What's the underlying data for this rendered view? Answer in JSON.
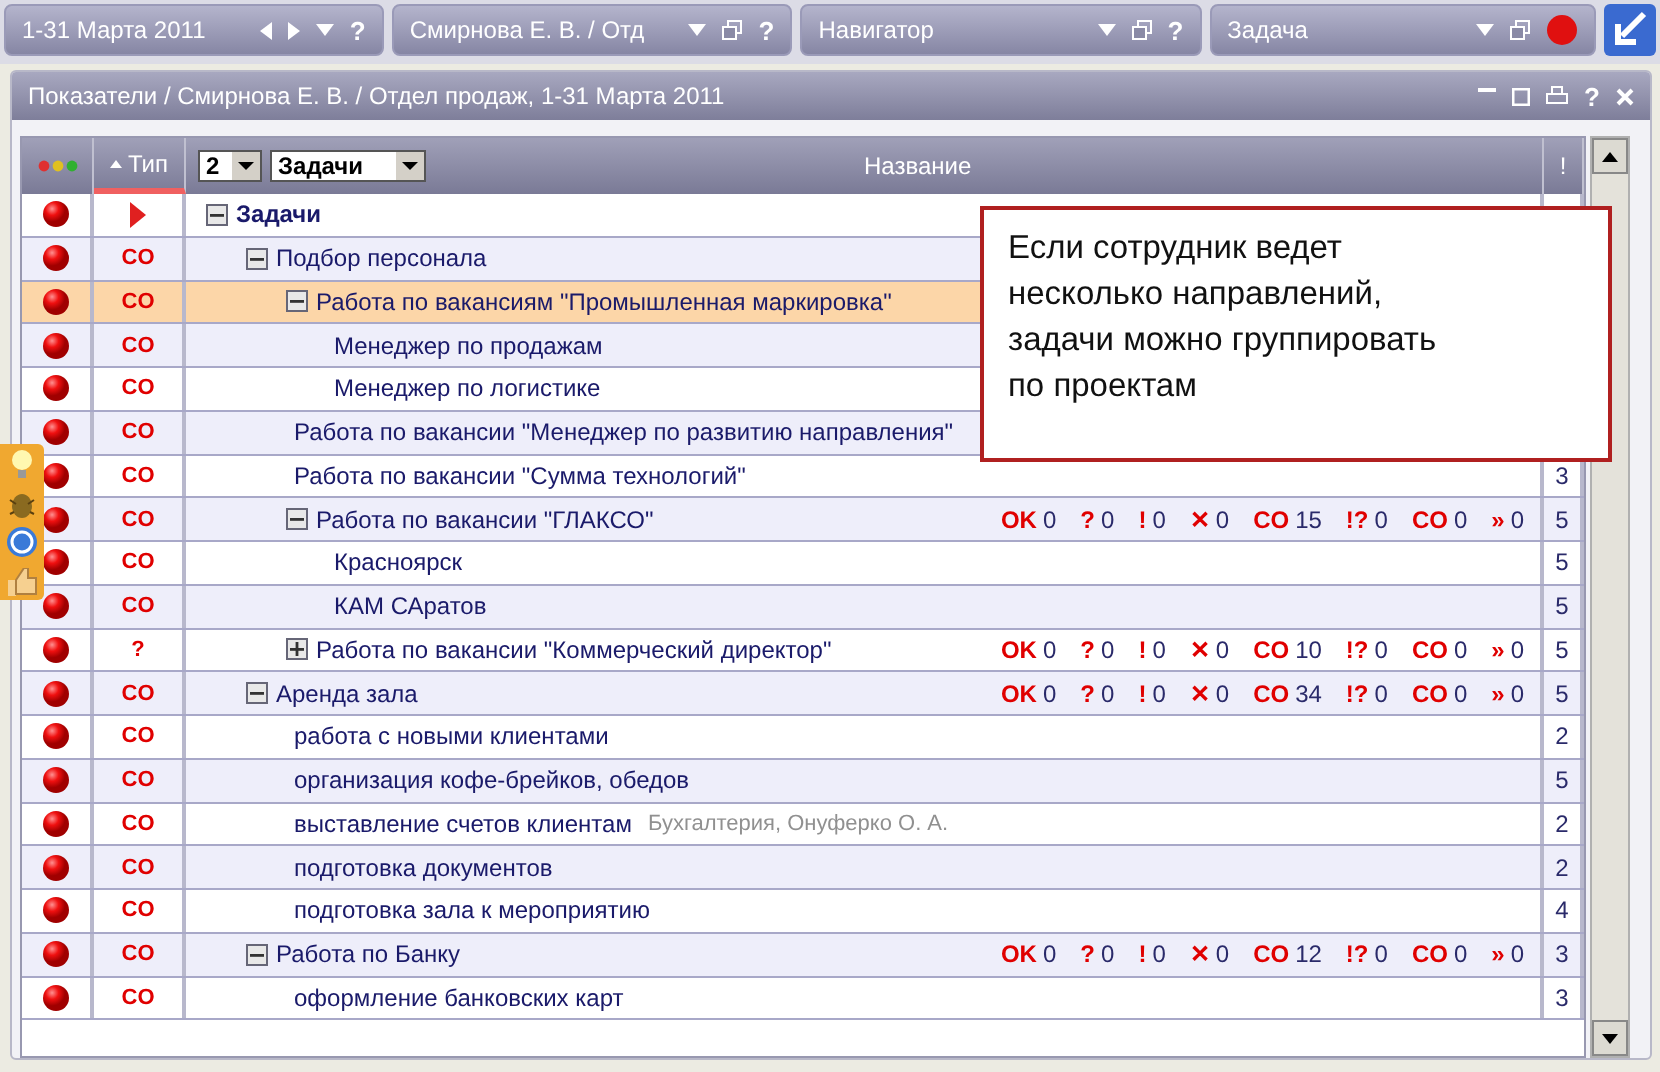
{
  "top_bar": [
    {
      "label": "1-31 Марта 2011",
      "nav_arrows": true,
      "restore": false,
      "help": "?"
    },
    {
      "label": "Смирнова Е. В. / Отд",
      "nav_arrows": false,
      "restore": true,
      "help": "?"
    },
    {
      "label": "Навигатор",
      "nav_arrows": false,
      "restore": true,
      "help": "?"
    },
    {
      "label": "Задача",
      "nav_arrows": false,
      "restore": true,
      "notification": true
    }
  ],
  "window": {
    "title": "Показатели / Смирнова Е. В. / Отдел продаж, 1-31 Марта 2011",
    "help": "?"
  },
  "table": {
    "columns": {
      "type": "Тип",
      "level_select": "2",
      "group_select": "Задачи",
      "name": "Название",
      "count": "!"
    },
    "rows": [
      {
        "name": "Задачи",
        "type": {
          "kind": "arrow"
        },
        "expanded": true,
        "selected": false,
        "children": [
          {
            "name": "Подбор персонала",
            "type": {
              "kind": "text",
              "label": "CO"
            },
            "expanded": true,
            "selected": false,
            "children": [
              {
                "name": "Работа по вакансиям \"Промышленная маркировка\"",
                "type": {
                  "kind": "text",
                  "label": "CO"
                },
                "expanded": true,
                "selected": true,
                "children": [
                  {
                    "name": "Менеджер по продажам",
                    "type": {
                      "kind": "text",
                      "label": "CO"
                    },
                    "selected": false
                  },
                  {
                    "name": "Менеджер по логистике",
                    "type": {
                      "kind": "text",
                      "label": "CO"
                    },
                    "selected": false
                  }
                ]
              },
              {
                "name": "Работа по вакансии \"Менеджер по развитию направления\"",
                "type": {
                  "kind": "text",
                  "label": "CO"
                },
                "selected": false
              },
              {
                "name": "Работа по вакансии \"Сумма технологий\"",
                "type": {
                  "kind": "text",
                  "label": "CO"
                },
                "count": "3",
                "selected": false
              },
              {
                "name": "Работа по вакансии \"ГЛАКСО\"",
                "type": {
                  "kind": "text",
                  "label": "CO"
                },
                "count": "5",
                "expanded": true,
                "selected": false,
                "stats": [
                  {
                    "label": "OK",
                    "value": "0"
                  },
                  {
                    "label": "?",
                    "value": "0"
                  },
                  {
                    "label": "!",
                    "value": "0"
                  },
                  {
                    "label": "✕",
                    "value": "0"
                  },
                  {
                    "label": "CO",
                    "value": "15"
                  },
                  {
                    "label": "!?",
                    "value": "0"
                  },
                  {
                    "label": "CO",
                    "value": "0"
                  },
                  {
                    "label": "»",
                    "value": "0"
                  }
                ],
                "children": [
                  {
                    "name": "Красноярск",
                    "type": {
                      "kind": "text",
                      "label": "CO"
                    },
                    "count": "5",
                    "selected": false
                  },
                  {
                    "name": "КАМ САратов",
                    "type": {
                      "kind": "text",
                      "label": "CO"
                    },
                    "count": "5",
                    "selected": false
                  }
                ]
              },
              {
                "name": "Работа по вакансии \"Коммерческий директор\"",
                "type": {
                  "kind": "text",
                  "label": "?"
                },
                "count": "5",
                "expanded": false,
                "selected": false,
                "stats": [
                  {
                    "label": "OK",
                    "value": "0"
                  },
                  {
                    "label": "?",
                    "value": "0"
                  },
                  {
                    "label": "!",
                    "value": "0"
                  },
                  {
                    "label": "✕",
                    "value": "0"
                  },
                  {
                    "label": "CO",
                    "value": "10"
                  },
                  {
                    "label": "!?",
                    "value": "0"
                  },
                  {
                    "label": "CO",
                    "value": "0"
                  },
                  {
                    "label": "»",
                    "value": "0"
                  }
                ]
              }
            ]
          },
          {
            "name": "Аренда зала",
            "type": {
              "kind": "text",
              "label": "CO"
            },
            "count": "5",
            "expanded": true,
            "selected": false,
            "stats": [
              {
                "label": "OK",
                "value": "0"
              },
              {
                "label": "?",
                "value": "0"
              },
              {
                "label": "!",
                "value": "0"
              },
              {
                "label": "✕",
                "value": "0"
              },
              {
                "label": "CO",
                "value": "34"
              },
              {
                "label": "!?",
                "value": "0"
              },
              {
                "label": "CO",
                "value": "0"
              },
              {
                "label": "»",
                "value": "0"
              }
            ],
            "children": [
              {
                "name": "работа с новыми клиентами",
                "type": {
                  "kind": "text",
                  "label": "CO"
                },
                "count": "2",
                "selected": false
              },
              {
                "name": "организация кофе-брейков, обедов",
                "type": {
                  "kind": "text",
                  "label": "CO"
                },
                "count": "5",
                "selected": false
              },
              {
                "name": "выставление счетов клиентам",
                "note": "Бухгалтерия, Онуферко О. А.",
                "type": {
                  "kind": "text",
                  "label": "CO"
                },
                "count": "2",
                "selected": false
              },
              {
                "name": "подготовка документов",
                "type": {
                  "kind": "text",
                  "label": "CO"
                },
                "count": "2",
                "selected": false
              },
              {
                "name": "подготовка зала к мероприятию",
                "type": {
                  "kind": "text",
                  "label": "CO"
                },
                "count": "4",
                "selected": false
              }
            ]
          },
          {
            "name": "Работа по Банку",
            "type": {
              "kind": "text",
              "label": "CO"
            },
            "count": "3",
            "expanded": true,
            "selected": false,
            "stats": [
              {
                "label": "OK",
                "value": "0"
              },
              {
                "label": "?",
                "value": "0"
              },
              {
                "label": "!",
                "value": "0"
              },
              {
                "label": "✕",
                "value": "0"
              },
              {
                "label": "CO",
                "value": "12"
              },
              {
                "label": "!?",
                "value": "0"
              },
              {
                "label": "CO",
                "value": "0"
              },
              {
                "label": "»",
                "value": "0"
              }
            ],
            "children": [
              {
                "name": "оформление банковских карт",
                "type": {
                  "kind": "text",
                  "label": "CO"
                },
                "count": "3",
                "selected": false
              }
            ]
          }
        ]
      }
    ]
  },
  "callout": "Если сотрудник ведет несколько направлений, задачи можно группировать по проектам"
}
